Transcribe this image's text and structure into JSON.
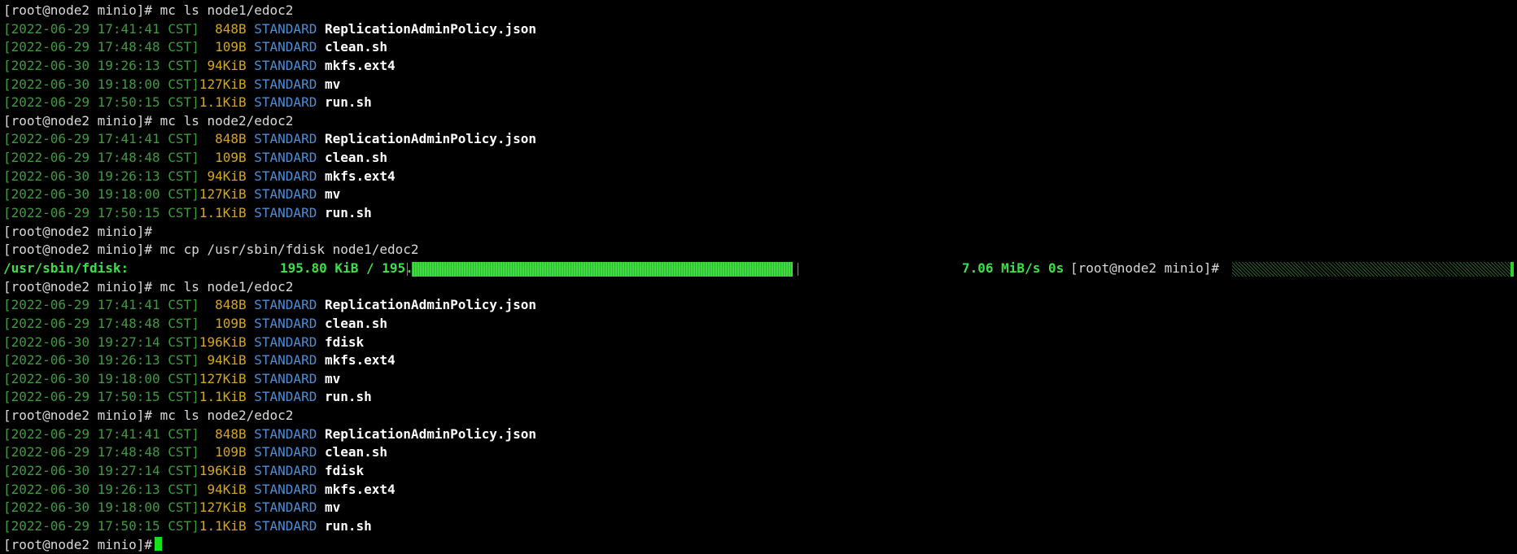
{
  "prompt": "[root@node2 minio]#",
  "lines": [
    {
      "type": "cmd",
      "command": "mc ls node1/edoc2"
    },
    {
      "type": "entry",
      "timestamp": "[2022-06-29 17:41:41 CST]",
      "size": "848B",
      "storage": "STANDARD",
      "name": "ReplicationAdminPolicy.json"
    },
    {
      "type": "entry",
      "timestamp": "[2022-06-29 17:48:48 CST]",
      "size": "109B",
      "storage": "STANDARD",
      "name": "clean.sh"
    },
    {
      "type": "entry",
      "timestamp": "[2022-06-30 19:26:13 CST]",
      "size": "94KiB",
      "storage": "STANDARD",
      "name": "mkfs.ext4"
    },
    {
      "type": "entry",
      "timestamp": "[2022-06-30 19:18:00 CST]",
      "size": "127KiB",
      "storage": "STANDARD",
      "name": "mv"
    },
    {
      "type": "entry",
      "timestamp": "[2022-06-29 17:50:15 CST]",
      "size": "1.1KiB",
      "storage": "STANDARD",
      "name": "run.sh"
    },
    {
      "type": "cmd",
      "command": "mc ls node2/edoc2"
    },
    {
      "type": "entry",
      "timestamp": "[2022-06-29 17:41:41 CST]",
      "size": "848B",
      "storage": "STANDARD",
      "name": "ReplicationAdminPolicy.json"
    },
    {
      "type": "entry",
      "timestamp": "[2022-06-29 17:48:48 CST]",
      "size": "109B",
      "storage": "STANDARD",
      "name": "clean.sh"
    },
    {
      "type": "entry",
      "timestamp": "[2022-06-30 19:26:13 CST]",
      "size": "94KiB",
      "storage": "STANDARD",
      "name": "mkfs.ext4"
    },
    {
      "type": "entry",
      "timestamp": "[2022-06-30 19:18:00 CST]",
      "size": "127KiB",
      "storage": "STANDARD",
      "name": "mv"
    },
    {
      "type": "entry",
      "timestamp": "[2022-06-29 17:50:15 CST]",
      "size": "1.1KiB",
      "storage": "STANDARD",
      "name": "run.sh"
    },
    {
      "type": "cmd",
      "command": ""
    },
    {
      "type": "cmd",
      "command": "mc cp /usr/sbin/fdisk node1/edoc2"
    },
    {
      "type": "progress",
      "file": "/usr/sbin/fdisk:",
      "transferred": "195.80 KiB / 195.80 KiB",
      "fraction": 1.0,
      "speed": "7.06 MiB/s 0s"
    },
    {
      "type": "cmd",
      "command": "mc ls node1/edoc2"
    },
    {
      "type": "entry",
      "timestamp": "[2022-06-29 17:41:41 CST]",
      "size": "848B",
      "storage": "STANDARD",
      "name": "ReplicationAdminPolicy.json"
    },
    {
      "type": "entry",
      "timestamp": "[2022-06-29 17:48:48 CST]",
      "size": "109B",
      "storage": "STANDARD",
      "name": "clean.sh"
    },
    {
      "type": "entry",
      "timestamp": "[2022-06-30 19:27:14 CST]",
      "size": "196KiB",
      "storage": "STANDARD",
      "name": "fdisk"
    },
    {
      "type": "entry",
      "timestamp": "[2022-06-30 19:26:13 CST]",
      "size": "94KiB",
      "storage": "STANDARD",
      "name": "mkfs.ext4"
    },
    {
      "type": "entry",
      "timestamp": "[2022-06-30 19:18:00 CST]",
      "size": "127KiB",
      "storage": "STANDARD",
      "name": "mv"
    },
    {
      "type": "entry",
      "timestamp": "[2022-06-29 17:50:15 CST]",
      "size": "1.1KiB",
      "storage": "STANDARD",
      "name": "run.sh"
    },
    {
      "type": "cmd",
      "command": "mc ls node2/edoc2"
    },
    {
      "type": "entry",
      "timestamp": "[2022-06-29 17:41:41 CST]",
      "size": "848B",
      "storage": "STANDARD",
      "name": "ReplicationAdminPolicy.json"
    },
    {
      "type": "entry",
      "timestamp": "[2022-06-29 17:48:48 CST]",
      "size": "109B",
      "storage": "STANDARD",
      "name": "clean.sh"
    },
    {
      "type": "entry",
      "timestamp": "[2022-06-30 19:27:14 CST]",
      "size": "196KiB",
      "storage": "STANDARD",
      "name": "fdisk"
    },
    {
      "type": "entry",
      "timestamp": "[2022-06-30 19:26:13 CST]",
      "size": "94KiB",
      "storage": "STANDARD",
      "name": "mkfs.ext4"
    },
    {
      "type": "entry",
      "timestamp": "[2022-06-30 19:18:00 CST]",
      "size": "127KiB",
      "storage": "STANDARD",
      "name": "mv"
    },
    {
      "type": "entry",
      "timestamp": "[2022-06-29 17:50:15 CST]",
      "size": "1.1KiB",
      "storage": "STANDARD",
      "name": "run.sh"
    },
    {
      "type": "active",
      "command": ""
    }
  ],
  "colors": {
    "background": "#000000",
    "timestamp": "#3f9a3f",
    "size": "#d6a423",
    "storage_class": "#4a8fd8",
    "filename": "#ffffff",
    "progress": "#3de048",
    "cursor": "#18e018"
  }
}
